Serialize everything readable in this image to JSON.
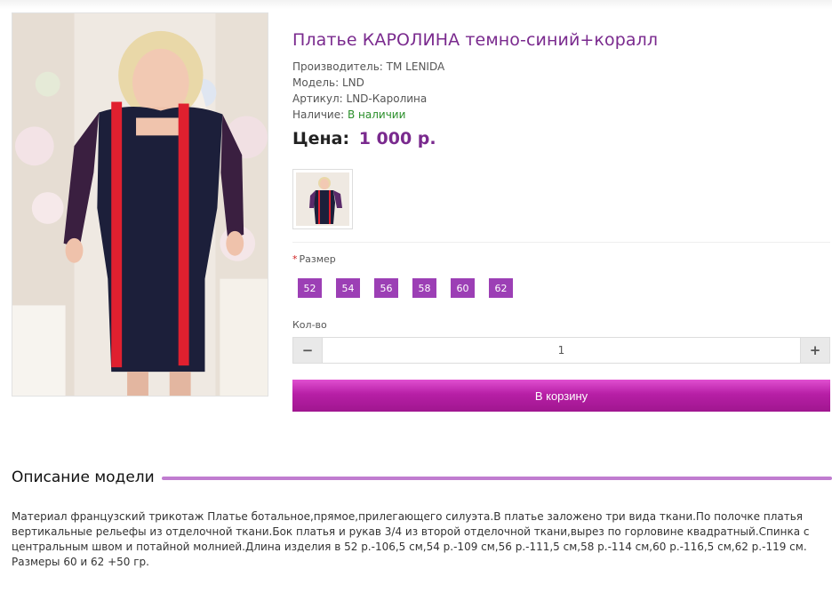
{
  "product": {
    "title": "Платье КАРОЛИНА темно-синий+коралл",
    "manufacturer_label": "Производитель:",
    "manufacturer_value": "TM LENIDA",
    "model_label": "Модель:",
    "model_value": "LND",
    "sku_label": "Артикул:",
    "sku_value": "LND-Каролина",
    "availability_label": "Наличие:",
    "availability_value": "В наличии",
    "price_label": "Цена:",
    "price_value": "1 000 р."
  },
  "options": {
    "required_mark": "*",
    "size_label": "Размер",
    "sizes": [
      "52",
      "54",
      "56",
      "58",
      "60",
      "62"
    ]
  },
  "quantity": {
    "label": "Кол-во",
    "value": "1",
    "minus": "−",
    "plus": "+"
  },
  "cart": {
    "button_label": "В корзину"
  },
  "description": {
    "heading": "Описание модели",
    "text": "Материал французский трикотаж Платье ботальное,прямое,прилегающего силуэта.В платье заложено три вида ткани.По полочке платья вертикальные рельефы из отделочной ткани.Бок платья и рукав 3/4 из второй отделочной ткани,вырез по горловине квадратный.Спинка с центральным швом и потайной молнией.Длина изделия в 52 р.-106,5 см,54 р.-109 см,56 р.-111,5 см,58 р.-114 см,60 р.-116,5 см,62 р.-119 см. Размеры 60 и 62 +50 гр."
  },
  "colors": {
    "accent": "#7a2a8e",
    "size_button": "#9c3fb5",
    "cart_button": "#b71fa6",
    "in_stock": "#2a8f2a",
    "dress_navy": "#1c1f3a",
    "dress_coral": "#e0202f"
  }
}
